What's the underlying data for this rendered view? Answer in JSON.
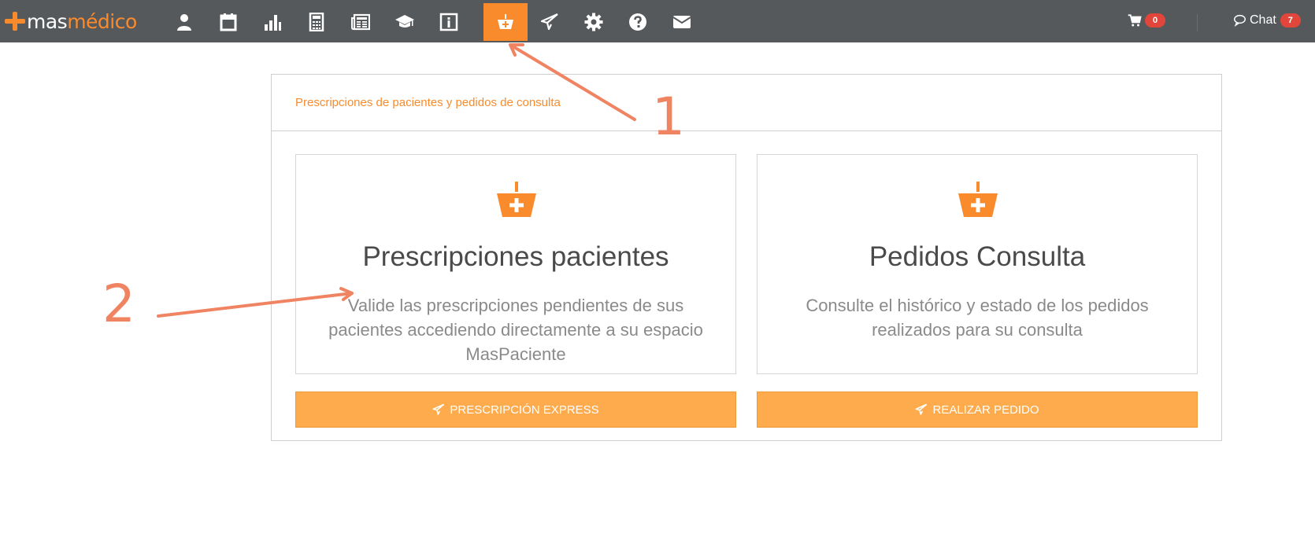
{
  "logo": {
    "mas": "mas",
    "medico": "médico"
  },
  "nav": {
    "icons": [
      {
        "name": "user-icon"
      },
      {
        "name": "calendar-icon"
      },
      {
        "name": "bar-chart-icon"
      },
      {
        "name": "calculator-icon"
      },
      {
        "name": "newspaper-icon"
      },
      {
        "name": "graduation-cap-icon"
      },
      {
        "name": "info-icon"
      },
      {
        "name": "basket-medical-icon",
        "active": true
      },
      {
        "name": "paper-plane-icon"
      },
      {
        "name": "gear-icon"
      },
      {
        "name": "question-icon"
      },
      {
        "name": "envelope-icon"
      }
    ],
    "cart_count": "0",
    "chat_label": "Chat",
    "chat_count": "7"
  },
  "panel": {
    "title": "Prescripciones de pacientes y pedidos de consulta",
    "cards": [
      {
        "title": "Prescripciones pacientes",
        "description": "Valide las prescripciones pendientes de sus pacientes accediendo directamente a su espacio MasPaciente",
        "button": "PRESCRIPCIÓN EXPRESS"
      },
      {
        "title": "Pedidos Consulta",
        "description": "Consulte el histórico y estado de los pedidos realizados para su consulta",
        "button": "REALIZAR PEDIDO"
      }
    ]
  },
  "annotations": {
    "one": "1",
    "two": "2"
  },
  "colors": {
    "navbar": "#56595c",
    "accent": "#f98b2d",
    "button": "#fdab4c",
    "annotation": "#f08462",
    "badge": "#e2463b"
  }
}
